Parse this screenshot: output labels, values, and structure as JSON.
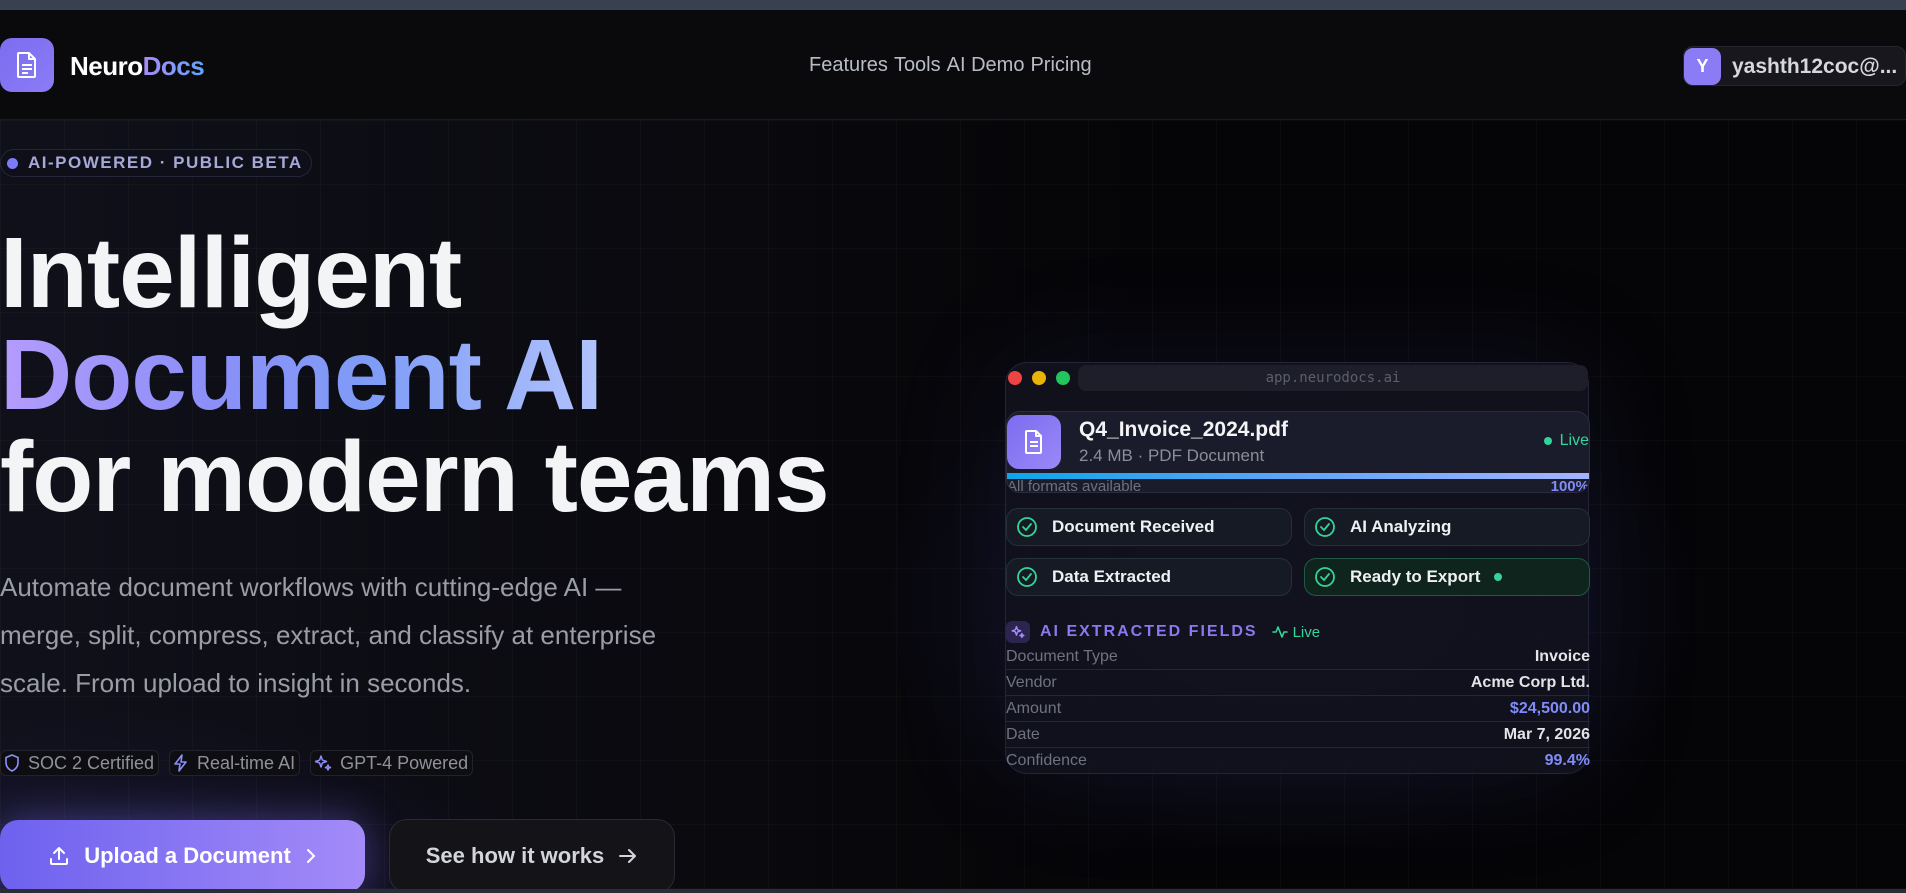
{
  "header": {
    "logo_part1": "Neuro",
    "logo_part2": "Docs",
    "nav": [
      "Features",
      "Tools",
      "AI Demo",
      "Pricing"
    ],
    "user": {
      "initial": "Y",
      "email": "yashth12coc@..."
    }
  },
  "hero": {
    "badge": "AI-POWERED · PUBLIC BETA",
    "headline_line1": "Intelligent",
    "headline_line2": "Document AI",
    "headline_line3": "for modern teams",
    "subtitle": "Automate document workflows with cutting-edge AI — merge, split, compress, extract, and classify at enterprise scale. From upload to insight in seconds.",
    "trust": [
      {
        "icon": "shield-icon",
        "label": "SOC 2 Certified"
      },
      {
        "icon": "lightning-icon",
        "label": "Real-time AI"
      },
      {
        "icon": "sparkles-icon",
        "label": "GPT-4 Powered"
      }
    ],
    "primary_cta": "Upload a Document",
    "secondary_cta": "See how it works"
  },
  "preview": {
    "url": "app.neurodocs.ai",
    "file": {
      "name": "Q4_Invoice_2024.pdf",
      "meta": "2.4 MB · PDF Document",
      "status": "Live",
      "progress_label": "All formats available",
      "progress_value": "100%",
      "progress_fraction": 1.0
    },
    "steps": [
      {
        "label": "Document Received",
        "active": false
      },
      {
        "label": "AI Analyzing",
        "active": false
      },
      {
        "label": "Data Extracted",
        "active": false
      },
      {
        "label": "Ready to Export",
        "active": true
      }
    ],
    "fields_title": "AI EXTRACTED FIELDS",
    "fields_live": "Live",
    "fields": [
      {
        "key": "Document Type",
        "value": "Invoice"
      },
      {
        "key": "Vendor",
        "value": "Acme Corp Ltd."
      },
      {
        "key": "Amount",
        "value": "$24,500.00"
      },
      {
        "key": "Date",
        "value": "Mar 7, 2026"
      },
      {
        "key": "Confidence",
        "value": "99.4%"
      }
    ]
  },
  "colors": {
    "accent": "#7c6cf0",
    "accent_light": "#a38bf8",
    "success": "#34d399",
    "background": "#050507"
  }
}
